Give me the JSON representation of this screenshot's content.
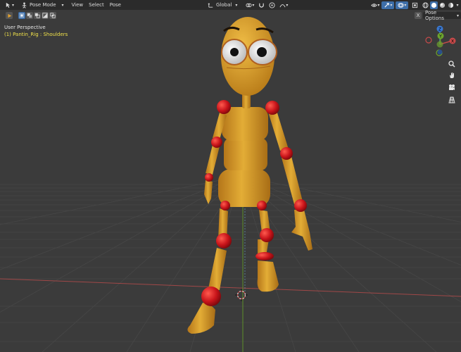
{
  "header": {
    "mode": "Pose Mode",
    "menus": [
      "View",
      "Select",
      "Pose"
    ],
    "transform_orientation": "Global",
    "pose_options": "Pose Options",
    "x_label": "X"
  },
  "viewport": {
    "perspective_label": "User Perspective",
    "active_label": "(1) Pantin_Rig : Shoulders"
  },
  "gizmo": {
    "z_label": "Z",
    "y_label": "Y",
    "x_label": "X"
  },
  "icons": {
    "editor_type": "cursor-icon",
    "zoom": "zoom-icon",
    "pan": "hand-icon",
    "camera": "camera-icon",
    "ortho": "grid-icon"
  },
  "colors": {
    "background": "#3a3a3a",
    "header": "#2b2b2b",
    "body": "#d9a22a",
    "joints": "#c8141a",
    "x_axis": "#c64a4a",
    "y_axis": "#6da52e",
    "z_axis": "#3a78d1",
    "active_text": "#f0e14a"
  }
}
